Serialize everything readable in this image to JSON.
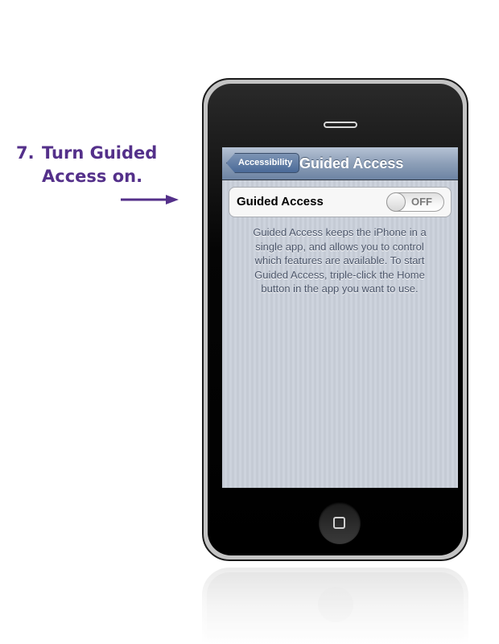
{
  "instruction": {
    "step_number": "7.",
    "step_line1": "Turn Guided",
    "step_line2": "Access on.",
    "color": "#54308a"
  },
  "nav": {
    "back_label": "Accessibility",
    "title": "Guided Access"
  },
  "setting": {
    "label": "Guided Access",
    "toggle_state": "OFF"
  },
  "footer_lines": [
    "Guided Access keeps the iPhone in a",
    "single app, and allows you to control",
    "which features are available. To start",
    "Guided Access, triple-click the Home",
    "button in the app you want to use."
  ],
  "icons": {
    "arrow": "arrow-right-icon",
    "home": "home-button-icon"
  }
}
